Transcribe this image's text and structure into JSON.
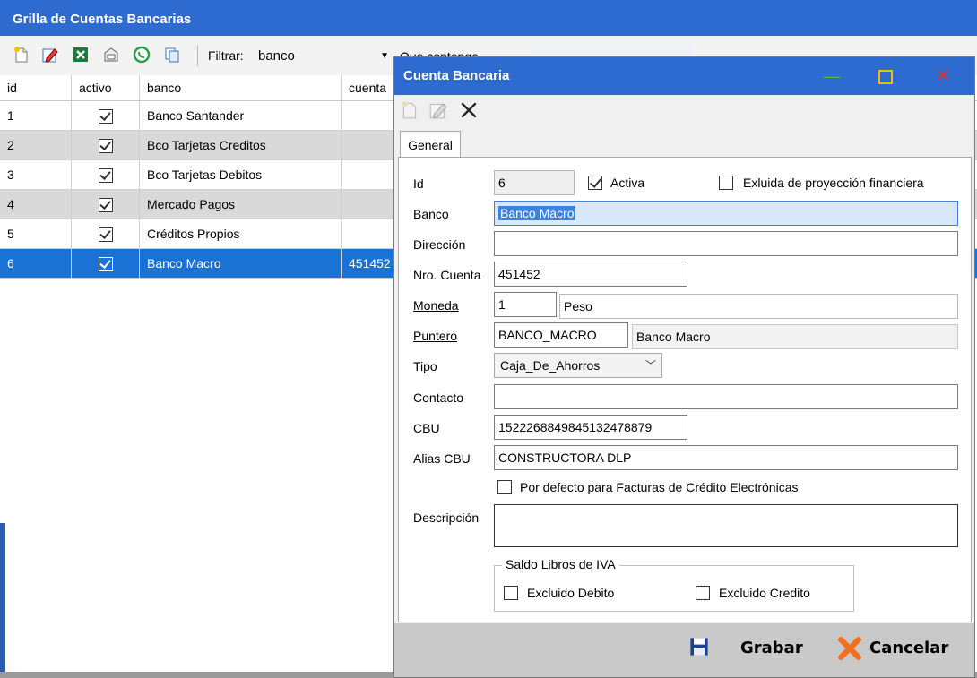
{
  "back_window": {
    "title": "Grilla de Cuentas Bancarias",
    "toolbar_icons": [
      "new-record-icon",
      "edit-record-icon",
      "excel-export-icon",
      "print-preview-icon",
      "whatsapp-icon",
      "copy-icon"
    ],
    "filter_label": "Filtrar:",
    "filter_field": "banco",
    "filter_condition": "Que contenga",
    "grid": {
      "columns": [
        "id",
        "activo",
        "banco",
        "cuenta"
      ],
      "rows": [
        {
          "id": "1",
          "activo": true,
          "banco": "Banco Santander",
          "cuenta": ""
        },
        {
          "id": "2",
          "activo": true,
          "banco": "Bco Tarjetas Creditos",
          "cuenta": ""
        },
        {
          "id": "3",
          "activo": true,
          "banco": "Bco Tarjetas Debitos",
          "cuenta": ""
        },
        {
          "id": "4",
          "activo": true,
          "banco": "Mercado Pagos",
          "cuenta": ""
        },
        {
          "id": "5",
          "activo": true,
          "banco": "Créditos Propios",
          "cuenta": ""
        },
        {
          "id": "6",
          "activo": true,
          "banco": "Banco Macro",
          "cuenta": "451452"
        }
      ],
      "selected_row": 6
    }
  },
  "dialog": {
    "title": "Cuenta Bancaria",
    "tab": "General",
    "fields": {
      "id_label": "Id",
      "id_value": "6",
      "activa_label": "Activa",
      "activa_checked": true,
      "excluida_label": "Exluida de proyección financiera",
      "excluida_checked": false,
      "banco_label": "Banco",
      "banco_value": "Banco Macro",
      "direccion_label": "Dirección",
      "direccion_value": "",
      "nro_cuenta_label": "Nro. Cuenta",
      "nro_cuenta_value": "451452",
      "moneda_label": "Moneda",
      "moneda_code": "1",
      "moneda_name": "Peso",
      "puntero_label": "Puntero",
      "puntero_code": "BANCO_MACRO",
      "puntero_name": "Banco Macro",
      "tipo_label": "Tipo",
      "tipo_value": "Caja_De_Ahorros",
      "contacto_label": "Contacto",
      "contacto_value": "",
      "cbu_label": "CBU",
      "cbu_value": "1522268849845132478879",
      "alias_label": "Alias CBU",
      "alias_value": "CONSTRUCTORA DLP",
      "por_defecto_label": "Por defecto para Facturas de Crédito Electrónicas",
      "por_defecto_checked": false,
      "descripcion_label": "Descripción",
      "descripcion_value": "",
      "saldo_group_title": "Saldo Libros de IVA",
      "excluido_debito_label": "Excluido Debito",
      "excluido_credito_label": "Excluido Credito"
    },
    "footer": {
      "save_label": "Grabar",
      "cancel_label": "Cancelar"
    }
  },
  "colors": {
    "titlebar": "#2e6bd1",
    "selected_row": "#1a73d4",
    "minimize": "#4cc24c",
    "maximize": "#f0c000",
    "close": "#e03030"
  }
}
